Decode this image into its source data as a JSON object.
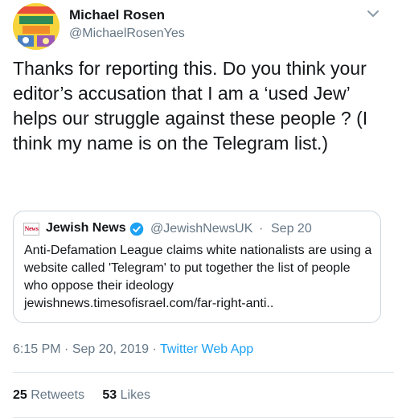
{
  "tweet": {
    "author_name": "Michael Rosen",
    "author_handle": "@MichaelRosenYes",
    "text": "Thanks for reporting this. Do you think your editor’s accusation that I am a ‘used Jew’ helps our struggle against these people ? (I think my name is on the Telegram list.)",
    "avatar_icon": "book-cover-avatar",
    "menu_icon": "chevron-down-icon"
  },
  "quoted": {
    "logo_text": "News",
    "name": "Jewish News",
    "handle": "@JewishNewsUK",
    "separator": "·",
    "date": "Sep 20",
    "text": "Anti-Defamation League claims white nationalists are using a website called 'Telegram' to put together the list of people who oppose their ideology",
    "link": "jewishnews.timesofisrael.com/far-right-anti..",
    "verified_color": "#1da1f2"
  },
  "meta": {
    "time": "6:15 PM",
    "separator": "·",
    "date": "Sep 20, 2019",
    "source": "Twitter Web App"
  },
  "stats": {
    "retweets_count": "25",
    "retweets_label": "Retweets",
    "likes_count": "53",
    "likes_label": "Likes"
  },
  "colors": {
    "accent": "#1da1f2",
    "secondary_text": "#657786",
    "border": "#ccd6dd"
  }
}
